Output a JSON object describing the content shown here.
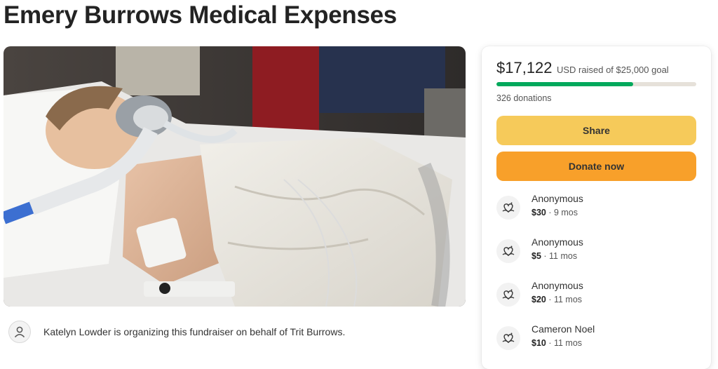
{
  "title": "Emery Burrows Medical Expenses",
  "hero": {
    "icon": "hospital-photo"
  },
  "organizer": {
    "icon": "user-icon",
    "text": "Katelyn Lowder is organizing this fundraiser on behalf of Trit Burrows."
  },
  "progress": {
    "raised": "$17,122",
    "raised_suffix": "USD raised of $25,000 goal",
    "fraction": 0.685,
    "donations": "326 donations",
    "fill_color": "#02a95c",
    "track_color": "#e6e1da"
  },
  "buttons": {
    "share": "Share",
    "donate": "Donate now",
    "share_color": "#f6ca5a",
    "donate_color": "#f8a02a"
  },
  "donations": [
    {
      "name": "Anonymous",
      "amount": "$30",
      "time": " · 9 mos",
      "icon": "donation-heart-icon"
    },
    {
      "name": "Anonymous",
      "amount": "$5",
      "time": " · 11 mos",
      "icon": "donation-heart-icon"
    },
    {
      "name": "Anonymous",
      "amount": "$20",
      "time": " · 11 mos",
      "icon": "donation-heart-icon"
    },
    {
      "name": "Cameron Noel",
      "amount": "$10",
      "time": " · 11 mos",
      "icon": "donation-heart-icon"
    }
  ]
}
